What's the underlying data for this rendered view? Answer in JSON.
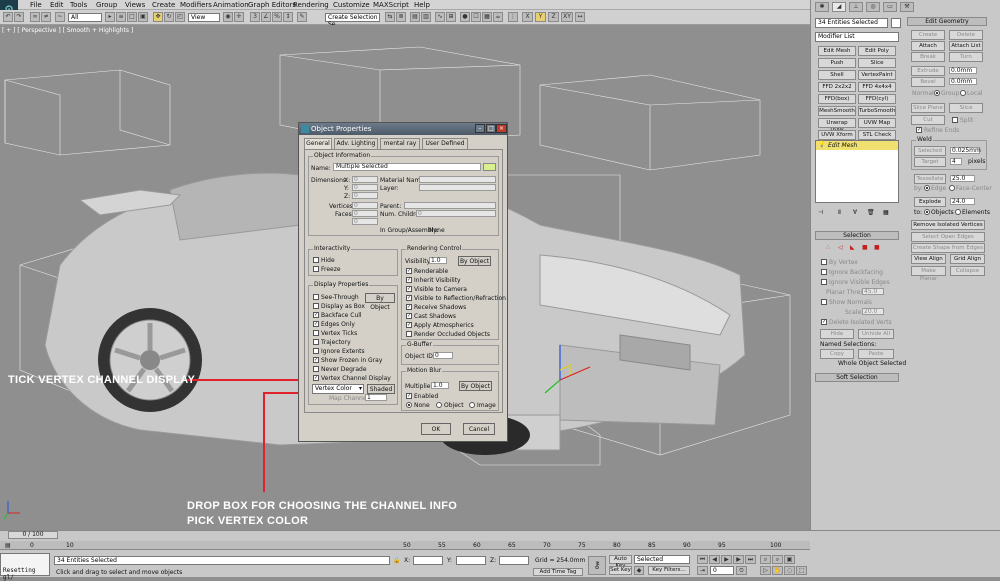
{
  "menu": [
    "File",
    "Edit",
    "Tools",
    "Group",
    "Views",
    "Create",
    "Modifiers",
    "Animation",
    "Graph Editors",
    "Rendering",
    "Customize",
    "MAXScript",
    "Help"
  ],
  "toolbar": {
    "filter": "All",
    "view": "View",
    "selection_set": "Create Selection Se",
    "axis_x": "X",
    "axis_y": "Y",
    "axis_xy": "XY"
  },
  "viewport": {
    "label": "[ + ] [ Perspective ] [ Smooth + Highlights ]"
  },
  "annotations": {
    "tick": "TICK VERTEX CHANNEL DISPLAY",
    "drop_line1": "DROP BOX FOR CHOOSING THE CHANNEL INFO",
    "drop_line2": "PICK VERTEX COLOR"
  },
  "dialog": {
    "title": "Object Properties",
    "tabs": [
      "General",
      "Adv. Lighting",
      "mental ray",
      "User Defined"
    ],
    "object_info": {
      "title": "Object Information",
      "name_label": "Name:",
      "name_value": "Multiple Selected",
      "dimensions": "Dimensions:",
      "x": "X:",
      "y": "Y:",
      "z": "Z:",
      "x_val": "0",
      "y_val": "0",
      "z_val": "0",
      "material_name": "Material Name:",
      "layer": "Layer:",
      "vertices": "Vertices:",
      "faces": "Faces:",
      "vert_val": "0",
      "face_val": "0",
      "parent": "Parent:",
      "num_children": "Num. Children:",
      "children_val": "0",
      "in_group": "In Group/Assembly:",
      "in_group_val": "None",
      "extra": "0"
    },
    "interactivity": {
      "title": "Interactivity",
      "hide": "Hide",
      "freeze": "Freeze"
    },
    "display": {
      "title": "Display Properties",
      "by_object": "By Object",
      "items": [
        {
          "label": "See-Through",
          "checked": false
        },
        {
          "label": "Display as Box",
          "checked": false
        },
        {
          "label": "Backface Cull",
          "checked": true
        },
        {
          "label": "Edges Only",
          "checked": true
        },
        {
          "label": "Vertex Ticks",
          "checked": false
        },
        {
          "label": "Trajectory",
          "checked": false
        },
        {
          "label": "Ignore Extents",
          "checked": false
        },
        {
          "label": "Show Frozen in Gray",
          "checked": true
        },
        {
          "label": "Never Degrade",
          "checked": false
        },
        {
          "label": "Vertex Channel Display",
          "checked": true
        }
      ],
      "channel_select": "Vertex Color",
      "shaded": "Shaded",
      "map_channel": "Map Channel:",
      "map_val": "1"
    },
    "rendering": {
      "title": "Rendering Control",
      "visibility": "Visibility:",
      "vis_val": "1.0",
      "by_object": "By Object",
      "items": [
        {
          "label": "Renderable",
          "checked": true
        },
        {
          "label": "Inherit Visibility",
          "checked": true
        },
        {
          "label": "Visible to Camera",
          "checked": true
        },
        {
          "label": "Visible to Reflection/Refraction",
          "checked": true
        },
        {
          "label": "Receive Shadows",
          "checked": true
        },
        {
          "label": "Cast Shadows",
          "checked": true
        },
        {
          "label": "Apply Atmospherics",
          "checked": true
        },
        {
          "label": "Render Occluded Objects",
          "checked": false
        }
      ]
    },
    "gbuffer": {
      "title": "G-Buffer",
      "object_id": "Object ID:",
      "id_val": "0"
    },
    "motion_blur": {
      "title": "Motion Blur",
      "multiplier": "Multiplier:",
      "mult_val": "1.0",
      "by_object": "By Object",
      "enabled": "Enabled",
      "none": "None",
      "object": "Object",
      "image": "Image"
    },
    "ok": "OK",
    "cancel": "Cancel"
  },
  "right_panel": {
    "selection_name": "34 Entities Selected",
    "modifier_list": "Modifier List",
    "modifier_buttons": [
      [
        "Edit Mesh",
        "Edit Poly"
      ],
      [
        "Push",
        "Slice"
      ],
      [
        "Shell",
        "VertexPaint"
      ],
      [
        "FFD 2x2x2",
        "FFD 4x4x4"
      ],
      [
        "FFD(box)",
        "FFD(cyl)"
      ],
      [
        "MeshSmooth",
        "TurboSmooth"
      ],
      [
        "Unwrap UVW",
        "UVW Map"
      ],
      [
        "UVW Xform",
        "STL Check"
      ]
    ],
    "stack_item": "Edit Mesh",
    "edit_geometry": {
      "title": "Edit Geometry",
      "create": "Create",
      "delete": "Delete",
      "attach": "Attach",
      "attach_list": "Attach List",
      "break": "Break",
      "turn": "Turn",
      "extrude": "Extrude",
      "extrude_val": "0.0mm",
      "bevel": "Bevel",
      "bevel_val": "0.0mm",
      "normal": "Normal:",
      "group": "Group",
      "local": "Local",
      "slice_plane": "Slice Plane",
      "slice": "Slice",
      "cut": "Cut",
      "split": "Split",
      "refine_ends": "Refine Ends",
      "weld": "Weld",
      "selected": "Selected",
      "selected_val": "0.025mm",
      "target": "Target",
      "target_val": "4",
      "pixels": "pixels",
      "tessellate": "Tessellate",
      "tess_val": "25.0",
      "by": "by:",
      "edge": "Edge",
      "face_center": "Face-Center",
      "explode": "Explode",
      "explode_val": "24.0",
      "to": "to:",
      "objects": "Objects",
      "elements": "Elements",
      "remove_iso": "Remove Isolated Vertices",
      "select_open": "Select Open Edges",
      "create_shape": "Create Shape from Edges",
      "view_align": "View Align",
      "grid_align": "Grid Align",
      "make_planar": "Make Planar",
      "collapse": "Collapse"
    },
    "selection": {
      "title": "Selection",
      "by_vertex": "By Vertex",
      "ignore_backfacing": "Ignore Backfacing",
      "ignore_visible": "Ignore Visible Edges",
      "planar_thresh": "Planar Thresh:",
      "planar_val": "45.0",
      "show_normals": "Show Normals",
      "scale": "Scale:",
      "scale_val": "20.0",
      "delete_isolated": "Delete Isolated Verts",
      "hide": "Hide",
      "unhide_all": "Unhide All",
      "named": "Named Selections:",
      "copy": "Copy",
      "paste": "Paste",
      "whole": "Whole Object Selected"
    },
    "soft_selection": "Soft Selection"
  },
  "bottom": {
    "time_slider": "0 / 100",
    "ticks": [
      "0",
      "10",
      "15",
      "20",
      "25",
      "30",
      "35",
      "40",
      "45",
      "50",
      "55",
      "60",
      "65",
      "70",
      "75",
      "80",
      "85",
      "90",
      "95",
      "100"
    ],
    "status": "34 Entities Selected",
    "prompt": "Click and drag to select and move objects",
    "script": "Resetting gl/",
    "x": "X:",
    "y": "Y:",
    "z": "Z:",
    "grid": "Grid = 254.0mm",
    "add_time_tag": "Add Time Tag",
    "auto_key": "Auto Key",
    "set_key": "Set Key",
    "selected": "Selected",
    "key_filters": "Key Filters...",
    "frame": "0"
  }
}
